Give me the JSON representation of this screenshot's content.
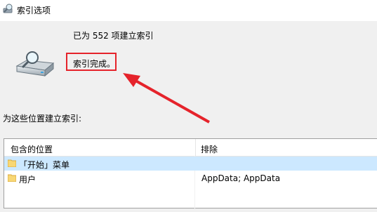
{
  "window": {
    "title": "索引选项"
  },
  "status": {
    "count_text": "已为 552 项建立索引",
    "state_text": "索引完成。"
  },
  "locations": {
    "label": "为这些位置建立索引:",
    "headers": {
      "location": "包含的位置",
      "exclude": "排除"
    },
    "rows": [
      {
        "location": "「开始」菜单",
        "exclude": "",
        "selected": true
      },
      {
        "location": "用户",
        "exclude": "AppData; AppData",
        "selected": false
      }
    ]
  },
  "colors": {
    "highlight_border": "#e5232b",
    "arrow": "#e5232b",
    "selected_row": "#cce8ff"
  }
}
